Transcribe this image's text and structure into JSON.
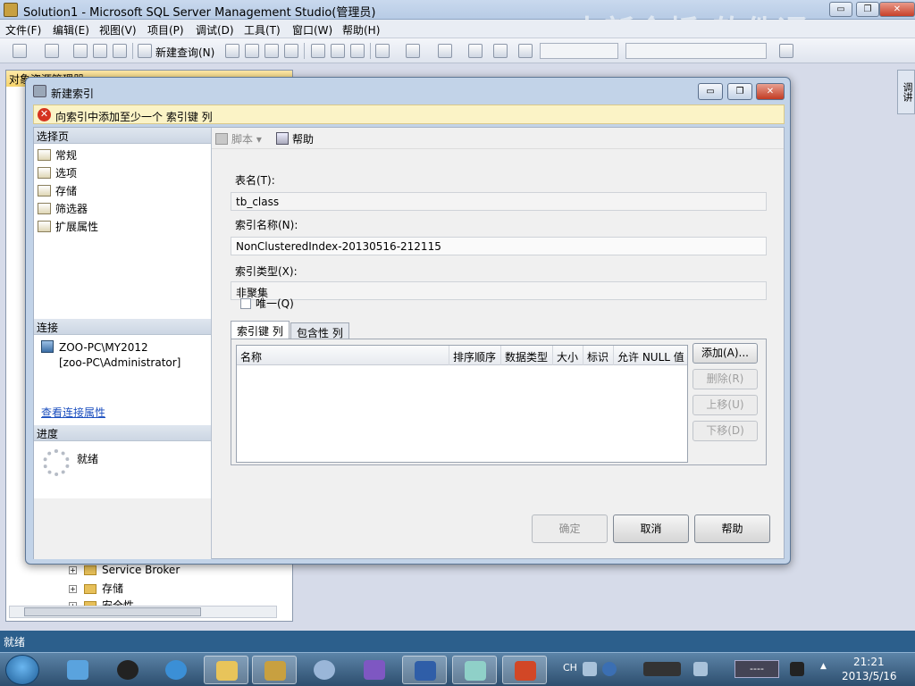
{
  "ssms": {
    "title": "Solution1 - Microsoft SQL Server Management Studio(管理员)",
    "watermark": "中新金桥 软件通",
    "window_controls": {
      "minimize": "▭",
      "restore": "❐",
      "close": "✕"
    },
    "menu": [
      "文件(F)",
      "编辑(E)",
      "视图(V)",
      "项目(P)",
      "调试(D)",
      "工具(T)",
      "窗口(W)",
      "帮助(H)"
    ],
    "toolbar": {
      "new_query": "新建查询(N)"
    },
    "object_explorer": {
      "title": "对象资源管理器",
      "tree": [
        "Service Broker",
        "存储",
        "安全性"
      ]
    },
    "right_strip": "调讲",
    "status": "就绪"
  },
  "dialog": {
    "title": "新建索引",
    "window_controls": {
      "minimize": "▭",
      "restore": "❐",
      "close": "✕"
    },
    "error_message": "向索引中添加至少一个 索引键 列",
    "left_pane": {
      "select_page_header": "选择页",
      "pages": [
        {
          "label": "常规"
        },
        {
          "label": "选项"
        },
        {
          "label": "存储"
        },
        {
          "label": "筛选器"
        },
        {
          "label": "扩展属性"
        }
      ],
      "connection_header": "连接",
      "server": "ZOO-PC\\MY2012",
      "user": "[zoo-PC\\Administrator]",
      "view_connection_link": "查看连接属性",
      "progress_header": "进度",
      "progress_status": "就绪"
    },
    "toolbar": {
      "script": "脚本",
      "script_arrow": "▾",
      "help": "帮助"
    },
    "fields": {
      "table_name_label": "表名(T):",
      "table_name_value": "tb_class",
      "index_name_label": "索引名称(N):",
      "index_name_value": "NonClusteredIndex-20130516-212115",
      "index_type_label": "索引类型(X):",
      "index_type_value": "非聚集",
      "unique_label": "唯一(Q)"
    },
    "tabs": [
      {
        "label": "索引键 列",
        "active": true
      },
      {
        "label": "包含性 列",
        "active": false
      }
    ],
    "grid_columns": [
      "名称",
      "排序顺序",
      "数据类型",
      "大小",
      "标识",
      "允许 NULL 值"
    ],
    "side_buttons": {
      "add": "添加(A)...",
      "remove": "删除(R)",
      "move_up": "上移(U)",
      "move_down": "下移(D)"
    },
    "footer": {
      "ok": "确定",
      "cancel": "取消",
      "help": "帮助"
    }
  },
  "taskbar": {
    "language": "CH",
    "battery": "----",
    "time": "21:21",
    "date": "2013/5/16"
  }
}
